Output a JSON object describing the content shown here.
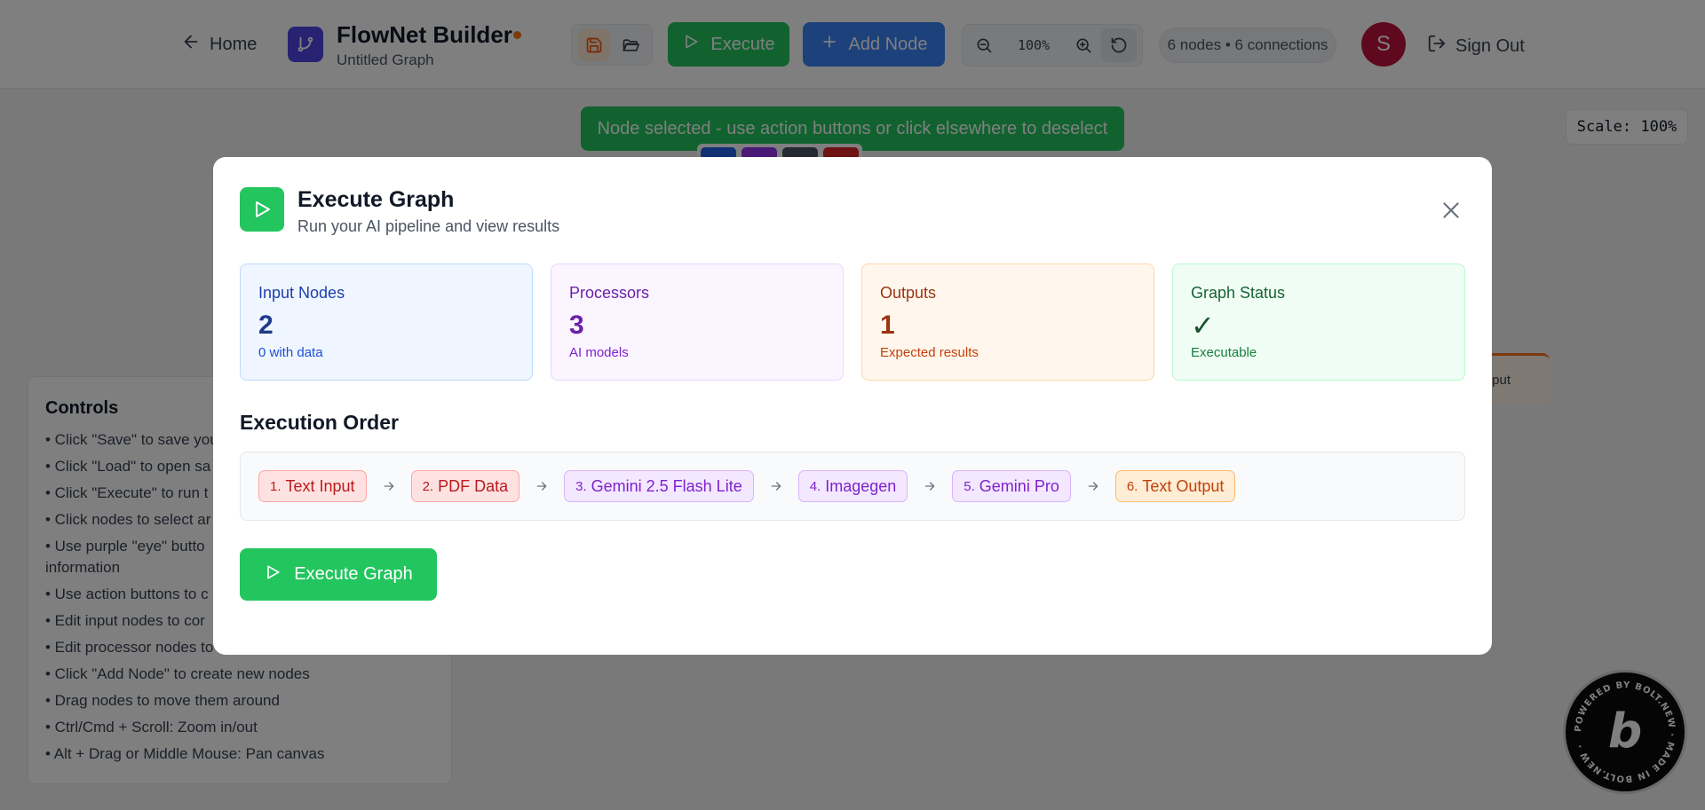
{
  "header": {
    "home_label": "Home",
    "app_title": "FlowNet Builder",
    "graph_name": "Untitled Graph",
    "execute_label": "Execute",
    "add_node_label": "Add Node",
    "zoom_level": "100%",
    "stats": "6 nodes • 6 connections",
    "avatar_initial": "S",
    "sign_out_label": "Sign Out",
    "colors": {
      "execute": "#22c55e",
      "add_node": "#3b82f6",
      "avatar": "#be123c",
      "unsaved_dot": "#f97316"
    }
  },
  "canvas": {
    "selection_banner": "Node selected - use action buttons or click elsewhere to deselect",
    "scale_label": "Scale: 100%",
    "bg_node_label": "put",
    "controls": {
      "title": "Controls",
      "items": [
        "• Click \"Save\" to save you",
        "• Click \"Load\" to open sa",
        "• Click \"Execute\" to run t",
        "• Click nodes to select ar",
        "• Use purple \"eye\" butto",
        "information",
        "• Use action buttons to c",
        "• Edit input nodes to cor",
        "• Edit processor nodes to",
        "• Click \"Add Node\" to create new nodes",
        "• Drag nodes to move them around",
        "• Ctrl/Cmd + Scroll: Zoom in/out",
        "• Alt + Drag or Middle Mouse: Pan canvas"
      ]
    },
    "bolt_badge_text": "POWERED BY BOLT.NEW · MADE IN BOLT.NEW ·",
    "bolt_badge_letter": "b"
  },
  "modal": {
    "title": "Execute Graph",
    "subtitle": "Run your AI pipeline and view results",
    "cards": [
      {
        "label": "Input Nodes",
        "value": "2",
        "sub": "0 with data"
      },
      {
        "label": "Processors",
        "value": "3",
        "sub": "AI models"
      },
      {
        "label": "Outputs",
        "value": "1",
        "sub": "Expected results"
      },
      {
        "label": "Graph Status",
        "value": "✓",
        "sub": "Executable"
      }
    ],
    "order_heading": "Execution Order",
    "steps": [
      {
        "num": "1.",
        "name": "Text Input",
        "kind": "input"
      },
      {
        "num": "2.",
        "name": "PDF Data",
        "kind": "input"
      },
      {
        "num": "3.",
        "name": "Gemini 2.5 Flash Lite",
        "kind": "processor"
      },
      {
        "num": "4.",
        "name": "Imagegen",
        "kind": "processor"
      },
      {
        "num": "5.",
        "name": "Gemini Pro",
        "kind": "processor"
      },
      {
        "num": "6.",
        "name": "Text Output",
        "kind": "output"
      }
    ],
    "run_button_label": "Execute Graph",
    "colors": {
      "accent": "#22c55e",
      "input": "#b91c1c",
      "processor": "#7e22ce",
      "output": "#c2410c"
    }
  }
}
